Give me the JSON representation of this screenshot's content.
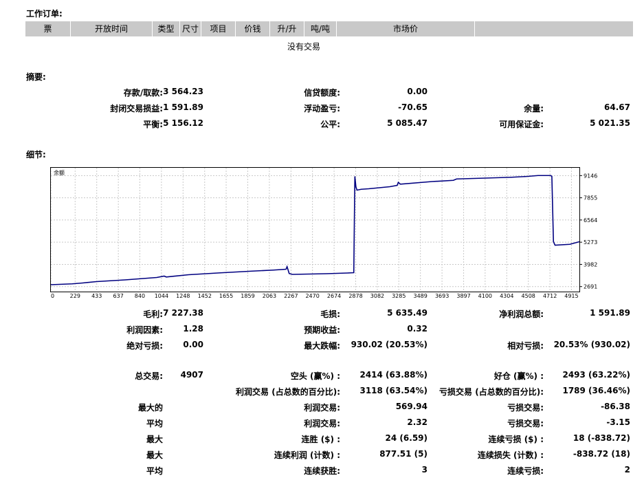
{
  "orders": {
    "title": "工作订单:",
    "columns": [
      "票",
      "开放时间",
      "类型",
      "尺寸",
      "项目",
      "价钱",
      "升/升",
      "吨/吨",
      "市场价",
      ""
    ],
    "empty_text": "没有交易"
  },
  "summary": {
    "title": "摘要:",
    "deposit_label": "存款/取款:",
    "deposit_value": "3 564.23",
    "credit_label": "信贷额度:",
    "credit_value": "0.00",
    "closed_pl_label": "封闭交易损益:",
    "closed_pl_value": "1 591.89",
    "floating_pl_label": "浮动盈亏:",
    "floating_pl_value": "-70.65",
    "margin_label": "余量:",
    "margin_value": "64.67",
    "balance_label": "平衡:",
    "balance_value": "5 156.12",
    "equity_label": "公平:",
    "equity_value": "5 085.47",
    "free_margin_label": "可用保证金:",
    "free_margin_value": "5 021.35"
  },
  "details": {
    "title": "细节:",
    "rows": [
      [
        "毛利:",
        "7 227.38",
        "毛损:",
        "5 635.49",
        "净利润总额:",
        "1 591.89"
      ],
      [
        "利润因素:",
        "1.28",
        "预期收益:",
        "0.32",
        "",
        ""
      ],
      [
        "绝对亏损:",
        "0.00",
        "最大跌幅:",
        "930.02 (20.53%)",
        "相对亏损:",
        "20.53% (930.02)"
      ],
      [
        "总交易:",
        "4907",
        "空头 (赢%) :",
        "2414 (63.88%)",
        "好仓 (赢%) :",
        "2493 (63.22%)"
      ],
      [
        "",
        "",
        "利润交易 (占总数的百分比):",
        "3118 (63.54%)",
        "亏损交易 (占总数的百分比):",
        "1789 (36.46%)"
      ],
      [
        "最大的",
        "",
        "利润交易:",
        "569.94",
        "亏损交易:",
        "-86.38"
      ],
      [
        "平均",
        "",
        "利润交易:",
        "2.32",
        "亏损交易:",
        "-3.15"
      ],
      [
        "最大",
        "",
        "连胜 ($) :",
        "24 (6.59)",
        "连续亏损 ($) :",
        "18 (-838.72)"
      ],
      [
        "最大",
        "",
        "连续利润 (计数) :",
        "877.51 (5)",
        "连续损失 (计数) :",
        "-838.72 (18)"
      ],
      [
        "平均",
        "",
        "连续获胜:",
        "3",
        "连续亏损:",
        "2"
      ]
    ]
  },
  "chart_data": {
    "type": "line",
    "title": "余额",
    "x_ticks": [
      0,
      229,
      433,
      637,
      840,
      1044,
      1248,
      1452,
      1655,
      1859,
      2063,
      2267,
      2470,
      2674,
      2878,
      3082,
      3285,
      3489,
      3693,
      3897,
      4100,
      4304,
      4508,
      4712,
      4915
    ],
    "y_ticks": [
      2691,
      3982,
      5273,
      6564,
      7855,
      9146
    ],
    "xlim": [
      0,
      4990
    ],
    "ylim": [
      2400,
      9600
    ],
    "grid": true,
    "series": [
      {
        "color": "#000080",
        "x": [
          0,
          200,
          300,
          430,
          700,
          1000,
          1070,
          1090,
          1300,
          1600,
          1900,
          2100,
          2220,
          2230,
          2250,
          2280,
          2600,
          2800,
          2860,
          2870,
          2880,
          2890,
          2930,
          3000,
          3200,
          3270,
          3280,
          3300,
          3600,
          3800,
          3830,
          4100,
          4350,
          4500,
          4600,
          4720,
          4730,
          4745,
          4760,
          4900,
          4990
        ],
        "y": [
          2800,
          2850,
          2900,
          2980,
          3080,
          3220,
          3300,
          3250,
          3380,
          3490,
          3590,
          3650,
          3700,
          3850,
          3450,
          3400,
          3440,
          3480,
          3500,
          9100,
          8500,
          8300,
          8350,
          8380,
          8500,
          8580,
          8750,
          8650,
          8800,
          8870,
          8950,
          9000,
          9050,
          9100,
          9150,
          9150,
          9100,
          5300,
          5100,
          5150,
          5300
        ]
      }
    ]
  }
}
